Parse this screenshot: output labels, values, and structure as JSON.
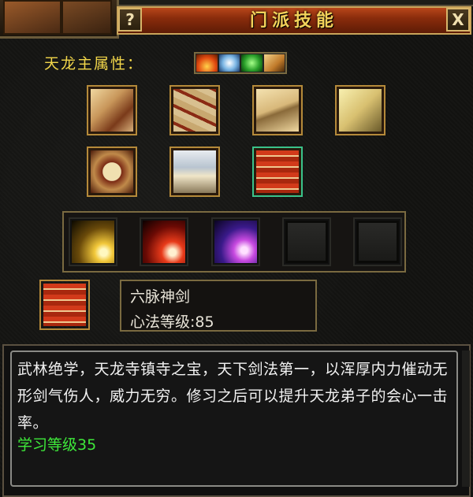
{
  "window": {
    "title": "门派技能",
    "help_label": "?",
    "close_label": "X"
  },
  "attributes": {
    "label": "天龙主属性：",
    "icons": [
      "fire-icon",
      "ice-icon",
      "poison-icon",
      "light-icon"
    ]
  },
  "skill_books": [
    {
      "name": "scroll-book"
    },
    {
      "name": "bundle-book"
    },
    {
      "name": "open-book"
    },
    {
      "name": "yellow-book"
    },
    {
      "name": "figure-book"
    },
    {
      "name": "blue-book"
    },
    {
      "name": "red-stack-book",
      "selected": true
    }
  ],
  "skills": [
    {
      "name": "yellow-burst-skill",
      "empty": false
    },
    {
      "name": "red-burst-skill",
      "empty": false
    },
    {
      "name": "purple-slash-skill",
      "empty": false
    },
    {
      "name": "empty-slot",
      "empty": true
    },
    {
      "name": "empty-slot",
      "empty": true
    }
  ],
  "current": {
    "skill_name": "六脉神剑",
    "level_text": "心法等级:85"
  },
  "description": {
    "text": "武林绝学，天龙寺镇寺之宝，天下剑法第一，以浑厚内力催动无形剑气伤人，威力无穷。修习之后可以提升天龙弟子的会心一击率。",
    "learn_level": "学习等级35"
  }
}
